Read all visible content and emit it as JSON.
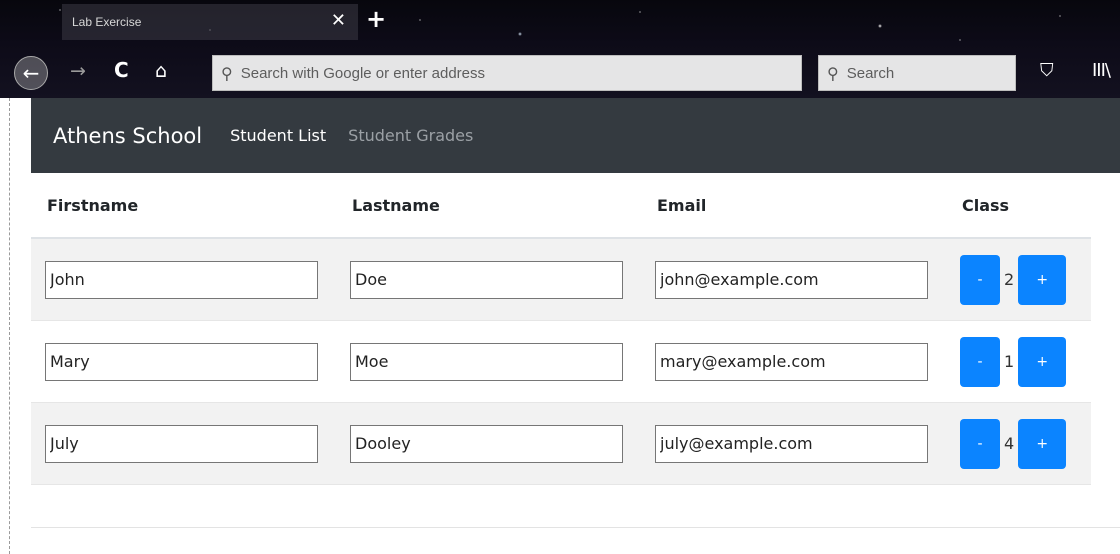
{
  "browser": {
    "tab_title": "Lab Exercise",
    "tab_close_glyph": "✕",
    "new_tab_glyph": "+",
    "back_glyph": "←",
    "forward_glyph": "→",
    "reload_glyph": "C",
    "home_glyph": "⌂",
    "url_placeholder": "Search with Google or enter address",
    "search_placeholder": "Search",
    "search_glyph": "⚲",
    "extensions_glyph": "⛉",
    "library_glyph": "III\\"
  },
  "navbar": {
    "brand": "Athens School",
    "links": [
      {
        "label": "Student List",
        "active": true
      },
      {
        "label": "Student Grades",
        "active": false
      }
    ]
  },
  "table": {
    "headers": [
      "Firstname",
      "Lastname",
      "Email",
      "Class"
    ],
    "rows": [
      {
        "firstname": "John",
        "lastname": "Doe",
        "email": "john@example.com",
        "class": "2"
      },
      {
        "firstname": "Mary",
        "lastname": "Moe",
        "email": "mary@example.com",
        "class": "1"
      },
      {
        "firstname": "July",
        "lastname": "Dooley",
        "email": "july@example.com",
        "class": "4"
      }
    ],
    "minus_label": "-",
    "plus_label": "+"
  },
  "colors": {
    "navbar_bg": "#343a40",
    "button_primary": "#0b84ff",
    "row_stripe": "#f2f2f2"
  }
}
